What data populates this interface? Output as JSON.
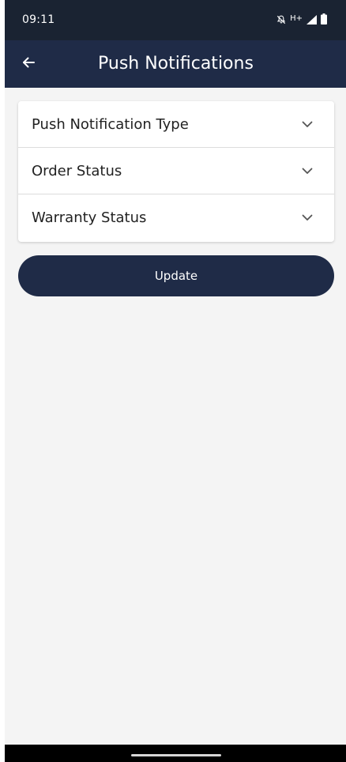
{
  "status_bar": {
    "time": "09:11",
    "network": "H+",
    "icons": [
      "notifications-off-icon",
      "signal-icon",
      "battery-icon"
    ]
  },
  "app_bar": {
    "title": "Push Notifications",
    "back_icon": "arrow-left-icon",
    "background": "#1f2b47"
  },
  "settings": {
    "items": [
      {
        "label": "Push Notification Type",
        "icon": "chevron-down-icon"
      },
      {
        "label": "Order Status",
        "icon": "chevron-down-icon"
      },
      {
        "label": "Warranty Status",
        "icon": "chevron-down-icon"
      }
    ]
  },
  "actions": {
    "update_label": "Update"
  },
  "colors": {
    "primary": "#1f2b47",
    "status_bar": "#1a2332",
    "background": "#f4f4f4",
    "card": "#ffffff"
  }
}
